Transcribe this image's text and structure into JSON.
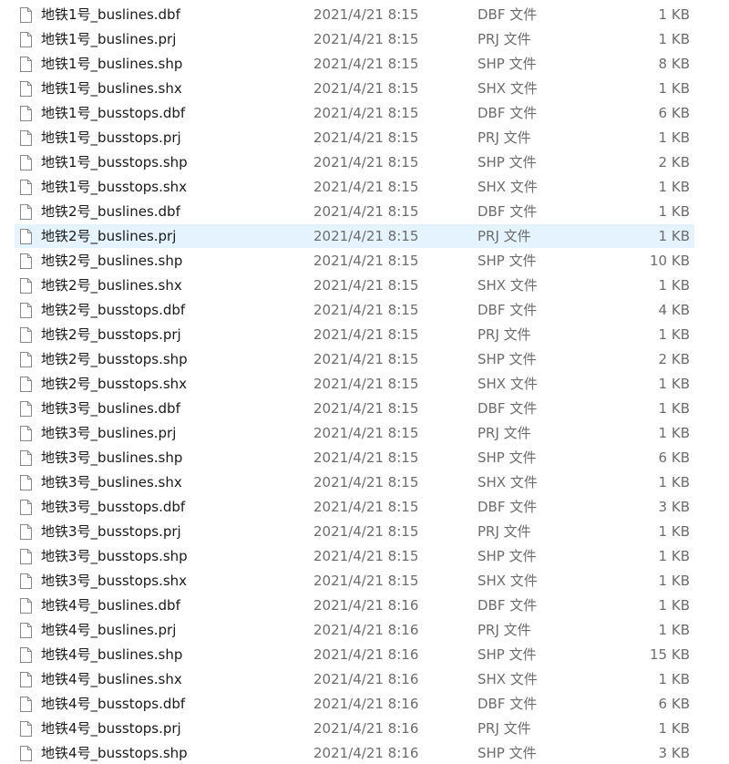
{
  "files": [
    {
      "name": "地铁1号_buslines.dbf",
      "date": "2021/4/21 8:15",
      "type": "DBF 文件",
      "size": "1 KB"
    },
    {
      "name": "地铁1号_buslines.prj",
      "date": "2021/4/21 8:15",
      "type": "PRJ 文件",
      "size": "1 KB"
    },
    {
      "name": "地铁1号_buslines.shp",
      "date": "2021/4/21 8:15",
      "type": "SHP 文件",
      "size": "8 KB"
    },
    {
      "name": "地铁1号_buslines.shx",
      "date": "2021/4/21 8:15",
      "type": "SHX 文件",
      "size": "1 KB"
    },
    {
      "name": "地铁1号_busstops.dbf",
      "date": "2021/4/21 8:15",
      "type": "DBF 文件",
      "size": "6 KB"
    },
    {
      "name": "地铁1号_busstops.prj",
      "date": "2021/4/21 8:15",
      "type": "PRJ 文件",
      "size": "1 KB"
    },
    {
      "name": "地铁1号_busstops.shp",
      "date": "2021/4/21 8:15",
      "type": "SHP 文件",
      "size": "2 KB"
    },
    {
      "name": "地铁1号_busstops.shx",
      "date": "2021/4/21 8:15",
      "type": "SHX 文件",
      "size": "1 KB"
    },
    {
      "name": "地铁2号_buslines.dbf",
      "date": "2021/4/21 8:15",
      "type": "DBF 文件",
      "size": "1 KB"
    },
    {
      "name": "地铁2号_buslines.prj",
      "date": "2021/4/21 8:15",
      "type": "PRJ 文件",
      "size": "1 KB",
      "selected": true
    },
    {
      "name": "地铁2号_buslines.shp",
      "date": "2021/4/21 8:15",
      "type": "SHP 文件",
      "size": "10 KB"
    },
    {
      "name": "地铁2号_buslines.shx",
      "date": "2021/4/21 8:15",
      "type": "SHX 文件",
      "size": "1 KB"
    },
    {
      "name": "地铁2号_busstops.dbf",
      "date": "2021/4/21 8:15",
      "type": "DBF 文件",
      "size": "4 KB"
    },
    {
      "name": "地铁2号_busstops.prj",
      "date": "2021/4/21 8:15",
      "type": "PRJ 文件",
      "size": "1 KB"
    },
    {
      "name": "地铁2号_busstops.shp",
      "date": "2021/4/21 8:15",
      "type": "SHP 文件",
      "size": "2 KB"
    },
    {
      "name": "地铁2号_busstops.shx",
      "date": "2021/4/21 8:15",
      "type": "SHX 文件",
      "size": "1 KB"
    },
    {
      "name": "地铁3号_buslines.dbf",
      "date": "2021/4/21 8:15",
      "type": "DBF 文件",
      "size": "1 KB"
    },
    {
      "name": "地铁3号_buslines.prj",
      "date": "2021/4/21 8:15",
      "type": "PRJ 文件",
      "size": "1 KB"
    },
    {
      "name": "地铁3号_buslines.shp",
      "date": "2021/4/21 8:15",
      "type": "SHP 文件",
      "size": "6 KB"
    },
    {
      "name": "地铁3号_buslines.shx",
      "date": "2021/4/21 8:15",
      "type": "SHX 文件",
      "size": "1 KB"
    },
    {
      "name": "地铁3号_busstops.dbf",
      "date": "2021/4/21 8:15",
      "type": "DBF 文件",
      "size": "3 KB"
    },
    {
      "name": "地铁3号_busstops.prj",
      "date": "2021/4/21 8:15",
      "type": "PRJ 文件",
      "size": "1 KB"
    },
    {
      "name": "地铁3号_busstops.shp",
      "date": "2021/4/21 8:15",
      "type": "SHP 文件",
      "size": "1 KB"
    },
    {
      "name": "地铁3号_busstops.shx",
      "date": "2021/4/21 8:15",
      "type": "SHX 文件",
      "size": "1 KB"
    },
    {
      "name": "地铁4号_buslines.dbf",
      "date": "2021/4/21 8:16",
      "type": "DBF 文件",
      "size": "1 KB"
    },
    {
      "name": "地铁4号_buslines.prj",
      "date": "2021/4/21 8:16",
      "type": "PRJ 文件",
      "size": "1 KB"
    },
    {
      "name": "地铁4号_buslines.shp",
      "date": "2021/4/21 8:16",
      "type": "SHP 文件",
      "size": "15 KB"
    },
    {
      "name": "地铁4号_buslines.shx",
      "date": "2021/4/21 8:16",
      "type": "SHX 文件",
      "size": "1 KB"
    },
    {
      "name": "地铁4号_busstops.dbf",
      "date": "2021/4/21 8:16",
      "type": "DBF 文件",
      "size": "6 KB"
    },
    {
      "name": "地铁4号_busstops.prj",
      "date": "2021/4/21 8:16",
      "type": "PRJ 文件",
      "size": "1 KB"
    },
    {
      "name": "地铁4号_busstops.shp",
      "date": "2021/4/21 8:16",
      "type": "SHP 文件",
      "size": "3 KB"
    }
  ],
  "icon": "generic-file-icon",
  "colors": {
    "selection": "#e5f3ff",
    "name_text": "#1a1a1a",
    "detail_text": "#6d6d6d"
  }
}
